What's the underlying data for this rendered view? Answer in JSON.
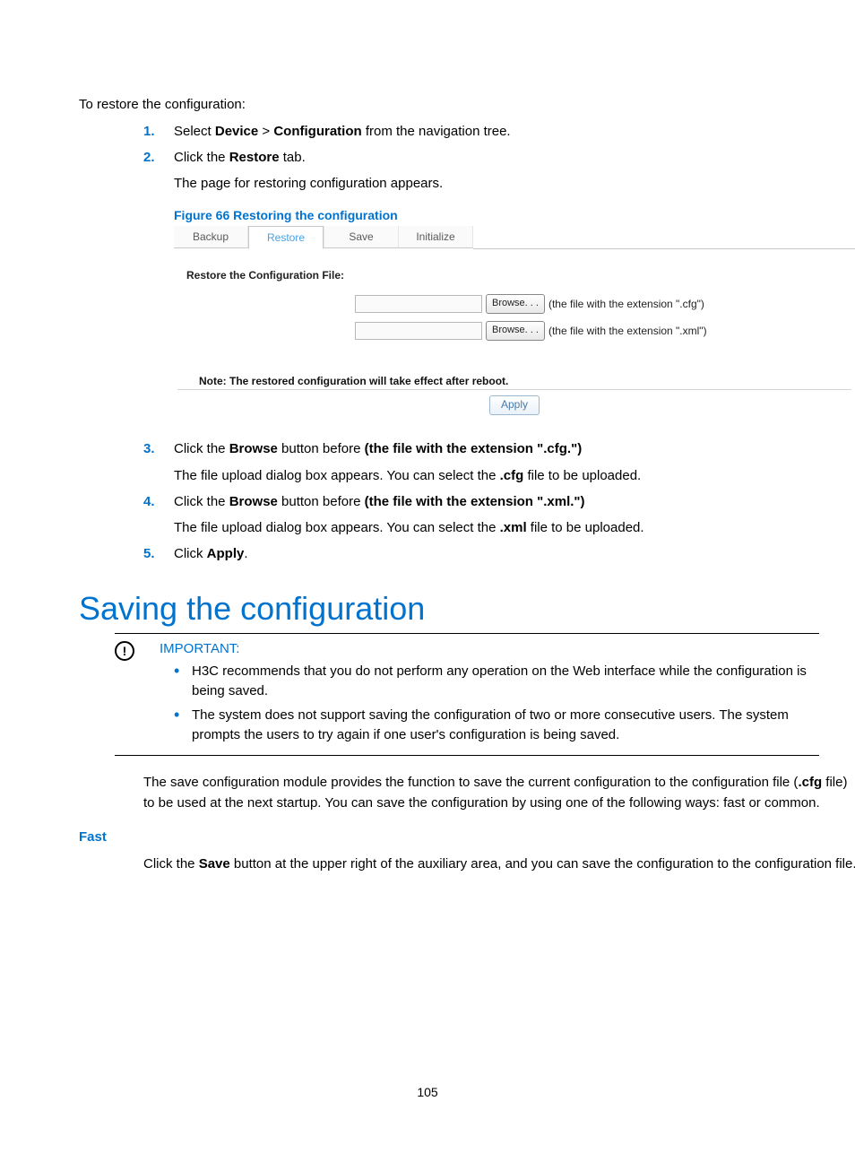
{
  "intro_line": "To restore the configuration:",
  "steps_a": [
    {
      "num": "1.",
      "parts": [
        "Select ",
        "Device",
        " > ",
        "Configuration",
        " from the navigation tree."
      ]
    },
    {
      "num": "2.",
      "line1": [
        "Click the ",
        "Restore",
        " tab."
      ],
      "line2": "The page for restoring configuration appears."
    }
  ],
  "figure_caption": "Figure 66 Restoring the configuration",
  "mock": {
    "tabs": [
      "Backup",
      "Restore",
      "Save",
      "Initialize"
    ],
    "section_label": "Restore the Configuration File:",
    "browse_label": "Browse. . .",
    "hint_cfg": "(the file with the extension \".cfg\")",
    "hint_xml": "(the file with the extension \".xml\")",
    "note": "Note: The restored configuration will take effect after reboot.",
    "apply": "Apply"
  },
  "steps_b": [
    {
      "num": "3.",
      "line1a": "Click the ",
      "line1b": "Browse",
      "line1c": " button before ",
      "line1d": "(the file with the extension \".cfg.\")",
      "line2a": "The file upload dialog box appears. You can select the ",
      "line2b": ".cfg",
      "line2c": " file to be uploaded."
    },
    {
      "num": "4.",
      "line1a": "Click the ",
      "line1b": "Browse",
      "line1c": " button before ",
      "line1d": "(the file with the extension \".xml.\")",
      "line2a": "The file upload dialog box appears. You can select the ",
      "line2b": ".xml",
      "line2c": " file to be uploaded."
    },
    {
      "num": "5.",
      "line1a": "Click ",
      "line1b": "Apply",
      "line1c": "."
    }
  ],
  "h1": "Saving the configuration",
  "callout": {
    "title": "IMPORTANT:",
    "items": [
      "H3C recommends that you do not perform any operation on the Web interface while the configuration is being saved.",
      "The system does not support saving the configuration of two or more consecutive users. The system prompts the users to try again if one user's configuration is being saved."
    ]
  },
  "body_para": {
    "a": "The save configuration module provides the function to save the current configuration to the configuration file (",
    "b": ".cfg",
    "c": " file) to be used at the next startup. You can save the configuration by using one of the following ways: fast or common."
  },
  "subhead": "Fast",
  "fast_para": {
    "a": "Click the ",
    "b": "Save",
    "c": " button at the upper right of the auxiliary area, and you can save the configuration to the configuration file."
  },
  "page_number": "105"
}
